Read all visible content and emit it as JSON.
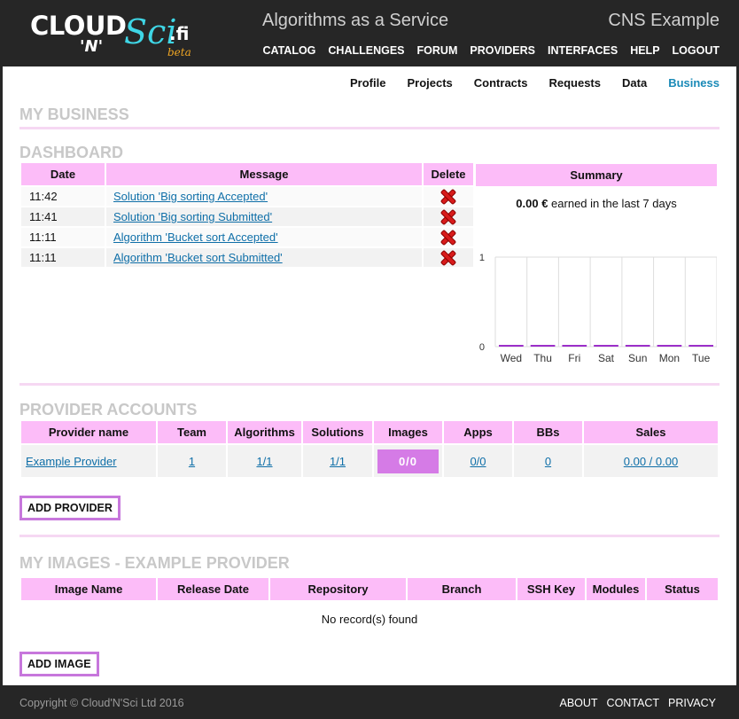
{
  "header": {
    "logo": {
      "cloud": "CLOUD",
      "n": "'N'",
      "sci": "Sci",
      "fi": ".fi",
      "beta": "beta"
    },
    "service_title": "Algorithms as a Service",
    "site_name": "CNS Example",
    "nav": [
      "CATALOG",
      "CHALLENGES",
      "FORUM",
      "PROVIDERS",
      "INTERFACES",
      "HELP",
      "LOGOUT"
    ]
  },
  "sub_nav": {
    "items": [
      "Profile",
      "Projects",
      "Contracts",
      "Requests",
      "Data",
      "Business"
    ],
    "active": "Business"
  },
  "page_title": "MY BUSINESS",
  "dashboard": {
    "title": "DASHBOARD",
    "columns": [
      "Date",
      "Message",
      "Delete"
    ],
    "rows": [
      {
        "time": "11:42",
        "message": "Solution 'Big sorting Accepted'"
      },
      {
        "time": "11:41",
        "message": "Solution 'Big sorting Submitted'"
      },
      {
        "time": "11:11",
        "message": "Algorithm 'Bucket sort Accepted'"
      },
      {
        "time": "11:11",
        "message": "Algorithm 'Bucket sort Submitted'"
      }
    ]
  },
  "summary": {
    "title": "Summary",
    "amount": "0.00 €",
    "earned_text": " earned in the last 7 days"
  },
  "chart_data": {
    "type": "bar",
    "categories": [
      "Wed",
      "Thu",
      "Fri",
      "Sat",
      "Sun",
      "Mon",
      "Tue"
    ],
    "values": [
      0,
      0,
      0,
      0,
      0,
      0,
      0
    ],
    "ylim": [
      0,
      1
    ],
    "yticks": [
      "1",
      "0"
    ],
    "title": "",
    "xlabel": "",
    "ylabel": "",
    "bar_color": "#9b2fc9",
    "grid": true
  },
  "provider_accounts": {
    "title": "PROVIDER ACCOUNTS",
    "columns": [
      "Provider name",
      "Team",
      "Algorithms",
      "Solutions",
      "Images",
      "Apps",
      "BBs",
      "Sales"
    ],
    "rows": [
      {
        "name": "Example Provider",
        "team": "1",
        "algorithms": "1/1",
        "solutions": "1/1",
        "images": "0/0",
        "apps": "0/0",
        "bbs": "0",
        "sales": "0.00 / 0.00"
      }
    ],
    "add_button": "ADD PROVIDER"
  },
  "my_images": {
    "title": "MY IMAGES - EXAMPLE PROVIDER",
    "columns": [
      "Image Name",
      "Release Date",
      "Repository",
      "Branch",
      "SSH Key",
      "Modules",
      "Status"
    ],
    "empty_text": "No record(s) found",
    "add_button": "ADD IMAGE"
  },
  "footer": {
    "copyright": "Copyright © Cloud'N'Sci Ltd 2016",
    "links": [
      "ABOUT",
      "CONTACT",
      "PRIVACY"
    ]
  },
  "colors": {
    "header_bg": "#262626",
    "table_header": "#fcbcf8",
    "accent_purple": "#d57be6",
    "active_tab": "#1a8ab7",
    "link": "#0f6fa8"
  }
}
